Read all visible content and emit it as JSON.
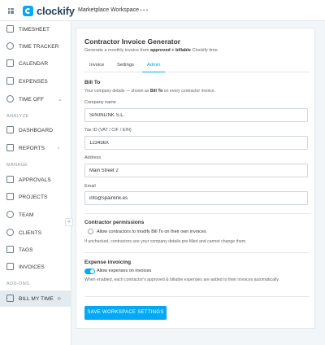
{
  "app": {
    "name": "clockify",
    "workspace": "Marketplace Workspace",
    "more": "•••"
  },
  "sidebar": {
    "items": [
      {
        "label": "TIMESHEET"
      },
      {
        "label": "TIME TRACKER"
      },
      {
        "label": "CALENDAR"
      },
      {
        "label": "EXPENSES"
      },
      {
        "label": "TIME OFF"
      }
    ],
    "section_analyze": "ANALYZE",
    "analyze_items": [
      {
        "label": "DASHBOARD"
      },
      {
        "label": "REPORTS"
      }
    ],
    "section_manage": "MANAGE",
    "manage_items": [
      {
        "label": "APPROVALS"
      },
      {
        "label": "PROJECTS"
      },
      {
        "label": "TEAM"
      },
      {
        "label": "CLIENTS"
      },
      {
        "label": "TAGS"
      },
      {
        "label": "INVOICES"
      }
    ],
    "section_addons": "ADD-ONS",
    "addon_items": [
      {
        "label": "BILL MY TIME",
        "active": true
      }
    ],
    "collapse_glyph": "«"
  },
  "page": {
    "title": "Contractor Invoice Generator",
    "subtitle_pre": "Generate a monthly invoice from ",
    "subtitle_bold": "approved + billable",
    "subtitle_post": " Clockify time.",
    "tabs": [
      {
        "label": "Invoice"
      },
      {
        "label": "Settings"
      },
      {
        "label": "Admin",
        "active": true
      }
    ],
    "bill_to": {
      "title": "Bill To",
      "hint_pre": "Your company details — shown as ",
      "hint_bold": "Bill To",
      "hint_post": " on every contractor invoice.",
      "fields": [
        {
          "label": "Company name",
          "value": "SPAINLINK S.L."
        },
        {
          "label": "Tax ID (VAT / CIF / EIN)",
          "value": "123456X"
        },
        {
          "label": "Address",
          "value": "Main Street 2"
        },
        {
          "label": "Email",
          "value": "info@spainlink.es"
        }
      ]
    },
    "contractor_permissions": {
      "title": "Contractor permissions",
      "option": "Allow contractors to modify Bill To on their own invoices",
      "checked": false,
      "hint": "If unchecked, contractors see your company details pre-filled and cannot change them."
    },
    "expense_invoicing": {
      "title": "Expense invoicing",
      "option": "Allow expenses on invoices",
      "enabled": true,
      "hint": "When enabled, each contractor's approved & billable expenses are added to their invoices automatically."
    },
    "save_button": "SAVE WORKSPACE SETTINGS"
  },
  "colors": {
    "accent": "#03a9f4",
    "brand_text": "#29445a",
    "background": "#f2f6f8"
  }
}
